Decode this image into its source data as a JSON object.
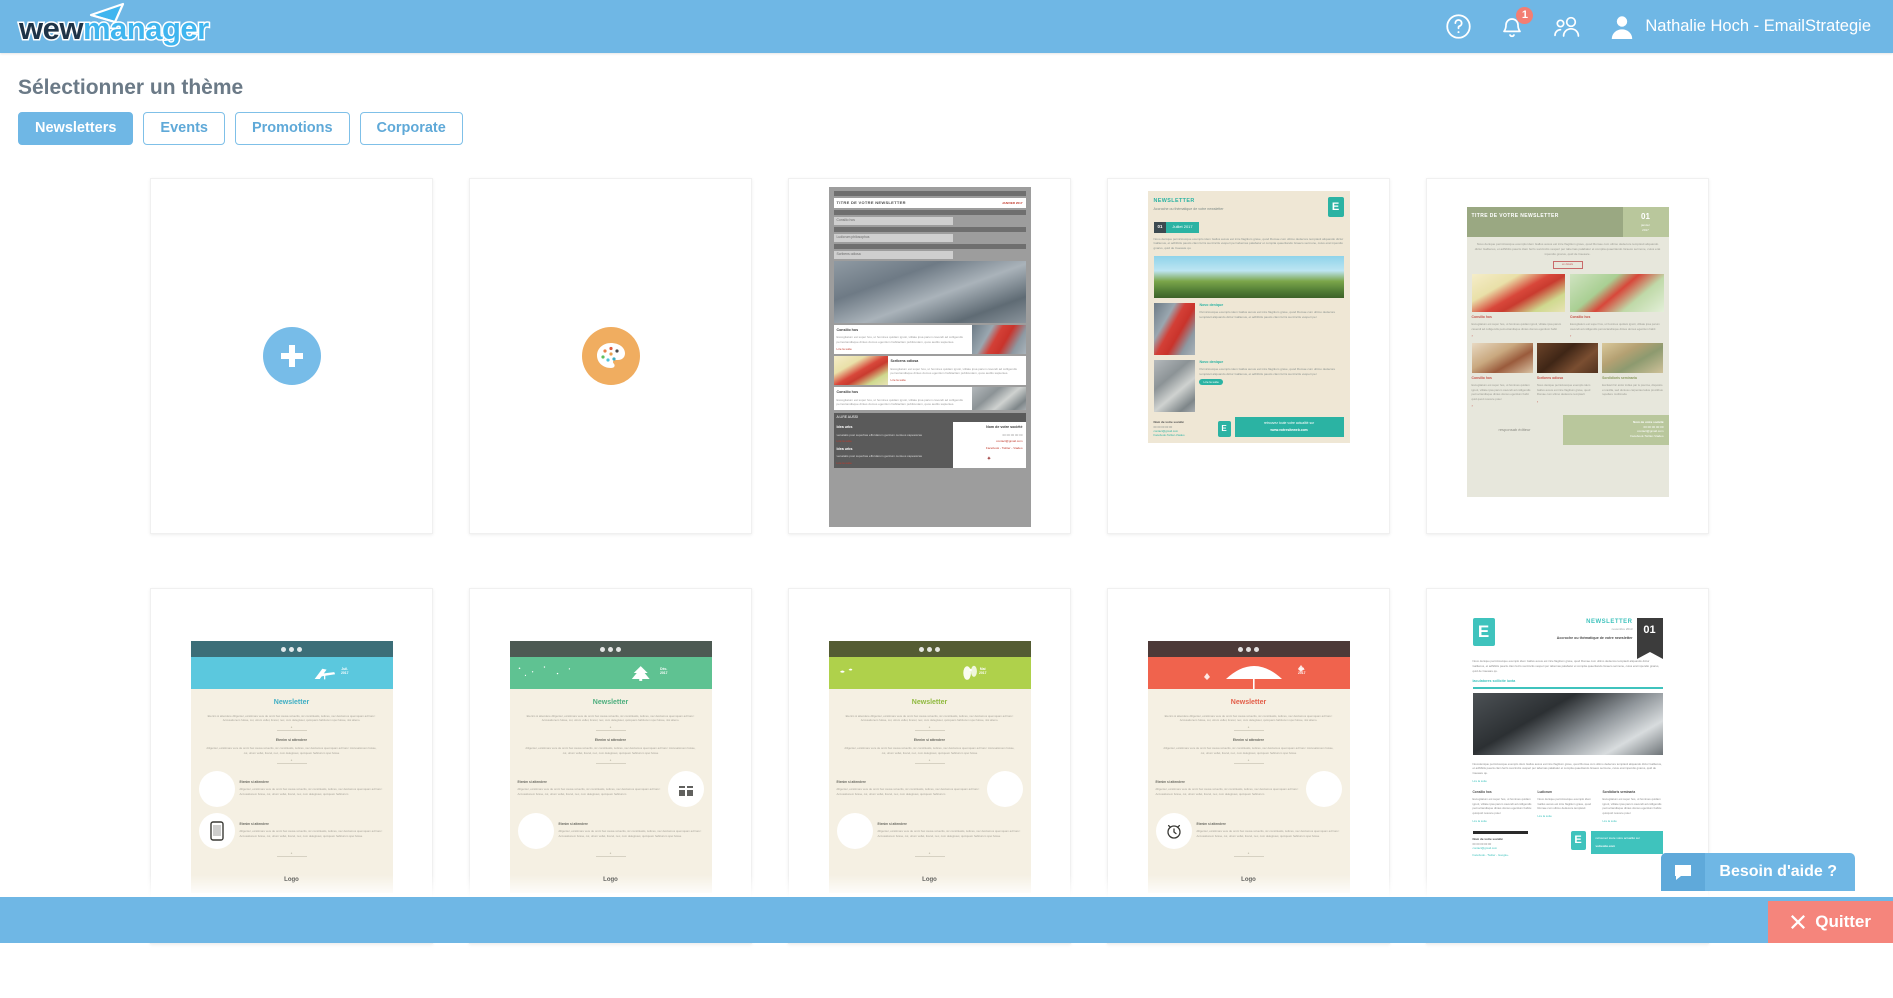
{
  "header": {
    "logo": {
      "part1": "wew",
      "part2": "manager",
      "icon": "paper-plane-icon"
    },
    "help_icon": "help-circle-icon",
    "notifications": {
      "icon": "bell-icon",
      "count": "1"
    },
    "contacts_icon": "users-icon",
    "avatar_icon": "user-avatar-icon",
    "user_name": "Nathalie Hoch - EmailStrategie"
  },
  "page": {
    "title": "Sélectionner un thème",
    "tabs": [
      {
        "label": "Newsletters",
        "active": true
      },
      {
        "label": "Events",
        "active": false
      },
      {
        "label": "Promotions",
        "active": false
      },
      {
        "label": "Corporate",
        "active": false
      }
    ]
  },
  "cards": {
    "blank": {
      "icon": "plus-circle-icon",
      "accent": "#77BCE8"
    },
    "palette": {
      "icon": "palette-icon",
      "accent": "#F0AD60"
    },
    "t3": {
      "title": "TITRE DE VOTRE NEWSLETTER",
      "date": "JANVIER 2017",
      "nav": [
        "Consilio hos",
        "Ludicrum philosophus",
        "Scribens odiosa"
      ],
      "blocks": [
        {
          "heading": "Consilio hos",
          "body": "Escogitatum est super hos, ut homines quidam ignoti, vilitate ipsa parum cavendi ad colligendis pernoctandisque dintes domus egentium habitaclam publicustam, quos audits sapientes.",
          "link": "Lire la suite"
        },
        {
          "heading": "Scribens odiosa",
          "body": "Escogitatum est super hos, ut homines quidam ignoti, vilitate ipsa parum cavendi ad colligendis pernoctandisque dintes domus egentium habitaclam publicustam, quos audits sapientes.",
          "link": "Lire la suite"
        }
      ],
      "also_title": "A LIRE AUSSI",
      "also_items": [
        {
          "heading": "Idea urbs",
          "body": "venatatis post superbas effordarum gentium centuos capessicas",
          "link": "Lire la suite"
        },
        {
          "heading": "Idea urbs",
          "body": "venatatis post superbas effordarum gentium centuos capessicas",
          "link": "Lire la suite"
        }
      ],
      "footer_company": "Nom de votre société",
      "footer_phone": "00 00 00 00 00",
      "footer_mail": "contact@gmail.com",
      "footer_social": "Facebook - Twitter - Viadeo"
    },
    "t4": {
      "title": "NEWSLETTER",
      "subtitle": "Accroche ou thématique de votre newsletter",
      "num": "01",
      "date": "Juillet 2017",
      "intro": "Novo denique pernicioscque exemplo idem Gallus auxus est inire flagitium grave, quod Romae cum ultimo dedecore temptavit aliquando dictur Gallienus, et adhibitis paucis clam ferris succinctis vesperi per tabernas palabatur et compita quaeritando Graeco sermone, cuius erat inpendio gnarus, quid de Caesare qu.",
      "articles": [
        {
          "heading": "Novo denique",
          "body": "Pernicioscque exemplo idem Gallus auxus est inire flagitium grave, quod Romae cum ultimo dedecore temptavit aliquando dictur Gallienus, et adhibitis paucis clam ferris succinctis vesperi per"
        },
        {
          "heading": "Novo denique",
          "body": "Pernicioscque exemplo idem Gallus auxus est inire flagitium grave, quod Romae cum ultimo dedecore temptavit aliquando dictur Gallienus, et adhibitis paucis clam ferris succinctis vesperi per",
          "button": "Lire la suite"
        }
      ],
      "footer_company": "Nom de votre société",
      "footer_phone": "00 00 00 00 00",
      "footer_mail": "contact@gmail.com",
      "footer_social": "Facebook-Twitter-Viadeo",
      "footer_right_1": "retrouvez toute votre actualité sur",
      "footer_right_2": "www.votresiteweb.com"
    },
    "t5": {
      "title": "TITRE DE VOTRE NEWSLETTER",
      "num": "01",
      "month": "janvier",
      "year": "2017",
      "intro": "Novo denique pernicioscque exemplo idem Gallus auxus est inire flagitium grave, quod Romae cum ultimo dedecore temptavit aliquando dictur Gallienus, et adhibitis paucis clam ferris succinctis vesperi per tabernas palabatur et compita quaeritando Graeco sermone, cuius erat inpendio gnarus, quid de Caesare.",
      "button": "en détails",
      "row1": [
        {
          "heading": "Consilio hos",
          "body": "Escogitatum est super hos, ut homines quidam ignoti, vilitate ipsa parum cavendi ad colligendis pernoctandisque dintes domus egentium habit"
        },
        {
          "heading": "Consilio hos",
          "body": "Escogitatum est super hos, ut homines quidam ignoti, vilitate ipsa parum cavendi ad colligendis pernoctandisque dintes domus egentium habit"
        }
      ],
      "row2": [
        {
          "heading": "Consilio hos",
          "body": "Escogitatum est super hos, ut homines quidam ignoti, vilitate ipsa parum cavendi ad colligendis pernoctandisque dintes domus egentium habit quid quod noscere poter"
        },
        {
          "heading": "Scribens odiosa",
          "body": "Novo denique pernicioscque exemplo idem Gallus auxus est inire flagitium grave, quod Romae cum ultimo dedecore temptavit"
        },
        {
          "heading": "Sordidioris seminaria",
          "body": "Excitavit hic ardor indles par is psurina, disposito et cavilla, sed dunioso carpentas latius procitibus repellere multimoda"
        }
      ],
      "logo_text": "responsab éditeur",
      "footer_company": "Nom de votre société",
      "footer_phone": "00 00 00 00 00",
      "footer_mail": "contact@gmail.com",
      "footer_social": "Facebook-Twitter-Viadeo"
    },
    "seasonal_common": {
      "title": "Newsletter",
      "lead": "Etenim si attendere diligenter, existimare vere de omni hac causa voluerits, sic constituatis, iudices, nec deiciamus quemquam ad hanc: Accusationem fuisse, cui, utrum vellet, licerel, nec, cum delegisset, quicquam habiturum spei fuisse, nisi alieno.",
      "section1_heading": "Etenim si attendere",
      "section1_body": "diligenter, existimare vere de omni hac causa voluerits, sic constituatis, iudices, nec deiciamus quemquam ad hanc: Accusationem fuisse, cui, utrum vellet, licerel, nec, cum delegisset, quicquam habiturum spei fuisse",
      "section2_heading": "Etenim si attendere",
      "section2_body": "diligenter, existimare vere de omni hac causa voluerits, sic constituatis, iudices, nec deiciamus quemquam ad hanc: Accusationem fuisse, cui, utrum vellet, licerel, nec, cum delegisset, quicquam habiturum",
      "logo": "Logo",
      "social_icons": [
        "facebook-icon",
        "twitter-icon",
        "linkedin-icon"
      ]
    },
    "t6": {
      "date_month": "Juil.",
      "date_year": "2017",
      "season": "summer-deckchair",
      "top_color": "#3C6E78",
      "hero_color": "#5BC8DE",
      "title_color": "#3FAEC4",
      "icon": "mobile-phone-icon"
    },
    "t7": {
      "date_month": "Déc.",
      "date_year": "2017",
      "season": "winter-tree",
      "top_color": "#4D5A53",
      "hero_color": "#5FC292",
      "title_color": "#4DAE7E",
      "icon": "gift-box-icon"
    },
    "t8": {
      "date_month": "Mai",
      "date_year": "2017",
      "season": "spring-birds",
      "top_color": "#545C33",
      "hero_color": "#AFD14B",
      "title_color": "#8FB93E",
      "icon": "leaf-icon"
    },
    "t9": {
      "date_month": "Oct.",
      "date_year": "2017",
      "season": "autumn-umbrella",
      "top_color": "#4D3A38",
      "hero_color": "#F0634D",
      "title_color": "#E35D48",
      "icon": "alarm-clock-icon"
    },
    "t10": {
      "brand_letter": "E",
      "title": "NEWSLETTER",
      "date": "novembre 2013",
      "accroche": "Accroche ou thématique de votre newsletter",
      "num": "01",
      "intro": "Novo denique pernicioscque exemplo idem Gallus auxus est inire flagitium grave, quod Romae cum ultimo dedecore temptavit aliquando dictur Gallienus, et adhibitis paucis clam ferris succinctis vesperi per tabernas palabatur et compita quaeritando Graeco sermone, cuius erat inpendio gnarus, quid de Caesare qu.",
      "section_heading": "Iaculatores sollicite iuxta",
      "body": "Novodenique pernicioscque exemplo idem Gallus auxus est inire flagitium grave, quod Romae cum ultimo dedecore temptavit aliquando dictur Gallienus, et adhibitis paucis clam ferris succinctis vesperi per tabernas palabatur et compita quaeritando Graeco sermone, cuius erat inpendio gnarus, quid de Caesare qu.",
      "link": "Lire la suite",
      "columns": [
        {
          "heading": "Consilio hos",
          "body": "Escogitatum est super hos, ut homines quidam ignoti, vilitate ipsa parum cavendi ad colligendis pernoctandisque dintes domus egentium habitu quicquid noscere poter",
          "link": "Lire la suite"
        },
        {
          "heading": "Ludicrum",
          "body": "Novo denique pernicioscque exemplo idem Gallus auxus est inire flagitium grave, quod Romae cum ultimo dedecore temptavit",
          "link": "Lire la suite"
        },
        {
          "heading": "Sordidioris seminaria",
          "body": "Escogitatum est super hos, ut homines quidam ignoti, vilitate ipsa parum cavendi ad colligendis pernoctandisque dintes domus egentium habitu quicquid noscere poter",
          "link": "Lire la suite"
        }
      ],
      "footer_company": "Nom de votre société",
      "footer_phone": "00 00 00 00 00",
      "footer_mail": "contact@gmail.com",
      "footer_social": "Facebook - Twitter - Google+",
      "footer_right_1": "retrouvez toute votre actualité sur",
      "footer_right_2": "votresite.com"
    }
  },
  "footer": {
    "chat_label": "Besoin d'aide ?",
    "chat_icon": "chat-bubble-icon",
    "quit_label": "Quitter",
    "quit_icon": "close-x-icon"
  }
}
